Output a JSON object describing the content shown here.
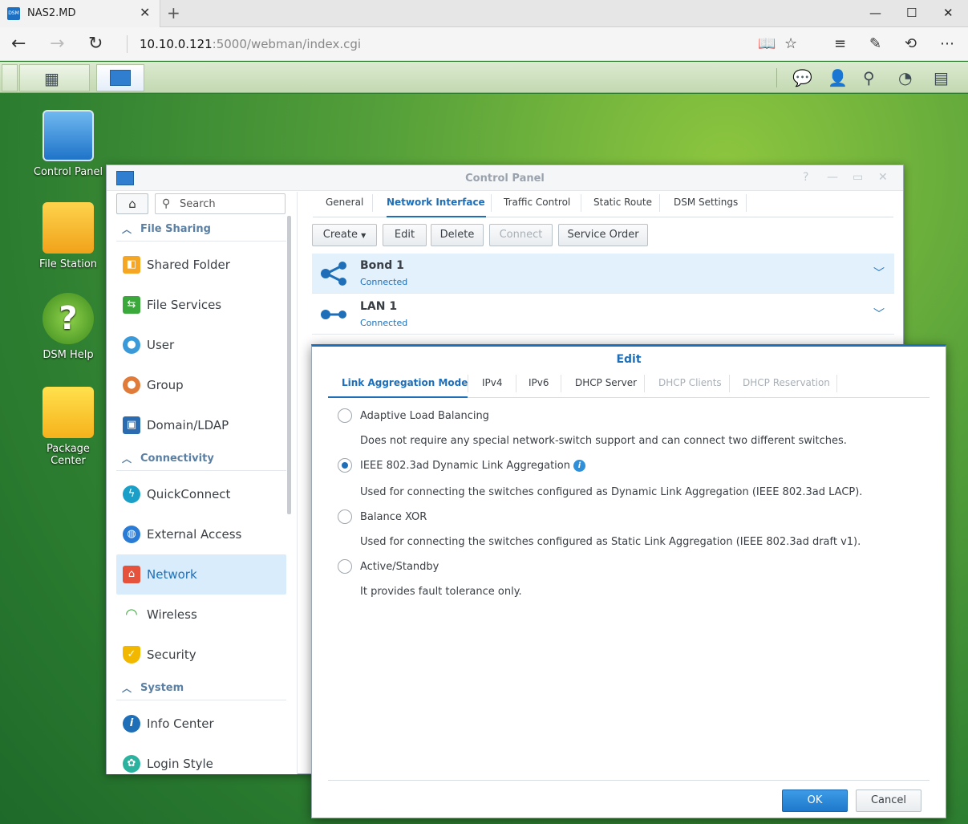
{
  "browser": {
    "tab_title": "NAS2.MD",
    "favicon_text": "DSM",
    "url_host": "10.10.0.121",
    "url_rest": ":5000/webman/index.cgi"
  },
  "desktop": {
    "items": [
      {
        "label": "Control Panel"
      },
      {
        "label": "File Station"
      },
      {
        "label": "DSM Help"
      },
      {
        "label": "Package Center"
      }
    ]
  },
  "control_panel": {
    "title": "Control Panel",
    "search_placeholder": "Search",
    "sidebar": {
      "sections": [
        {
          "label": "File Sharing"
        },
        {
          "label": "Connectivity"
        },
        {
          "label": "System"
        }
      ],
      "items": [
        {
          "label": "Shared Folder",
          "color": "#f5a623"
        },
        {
          "label": "File Services",
          "color": "#3aa83a"
        },
        {
          "label": "User",
          "color": "#3a9ad9"
        },
        {
          "label": "Group",
          "color": "#e07b39"
        },
        {
          "label": "Domain/LDAP",
          "color": "#2b6cb0"
        },
        {
          "label": "QuickConnect",
          "color": "#1aa0c8"
        },
        {
          "label": "External Access",
          "color": "#2a7bd5"
        },
        {
          "label": "Network",
          "color": "#e5533d"
        },
        {
          "label": "Wireless",
          "color": "#3aa83a"
        },
        {
          "label": "Security",
          "color": "#f2b800"
        },
        {
          "label": "Info Center",
          "color": "#1e6fb8"
        },
        {
          "label": "Login Style",
          "color": "#2bb3a0"
        }
      ]
    },
    "tabs": [
      "General",
      "Network Interface",
      "Traffic Control",
      "Static Route",
      "DSM Settings"
    ],
    "toolbar": {
      "create": "Create",
      "edit": "Edit",
      "delete": "Delete",
      "connect": "Connect",
      "service_order": "Service Order"
    },
    "interfaces": [
      {
        "name": "Bond 1",
        "status": "Connected"
      },
      {
        "name": "LAN 1",
        "status": "Connected"
      }
    ]
  },
  "edit_dialog": {
    "title": "Edit",
    "tabs": [
      "Link Aggregation Mode",
      "IPv4",
      "IPv6",
      "DHCP Server",
      "DHCP Clients",
      "DHCP Reservation"
    ],
    "options": [
      {
        "label": "Adaptive Load Balancing",
        "desc": "Does not require any special network-switch support and can connect two different switches.",
        "checked": false
      },
      {
        "label": "IEEE 802.3ad Dynamic Link Aggregation",
        "desc": "Used for connecting the switches configured as Dynamic Link Aggregation (IEEE 802.3ad LACP).",
        "checked": true
      },
      {
        "label": "Balance XOR",
        "desc": "Used for connecting the switches configured as Static Link Aggregation (IEEE 802.3ad draft v1).",
        "checked": false
      },
      {
        "label": "Active/Standby",
        "desc": "It provides fault tolerance only.",
        "checked": false
      }
    ],
    "ok": "OK",
    "cancel": "Cancel"
  },
  "colors": {
    "accent": "#1e6fb8",
    "selection": "#e2f1fc"
  }
}
